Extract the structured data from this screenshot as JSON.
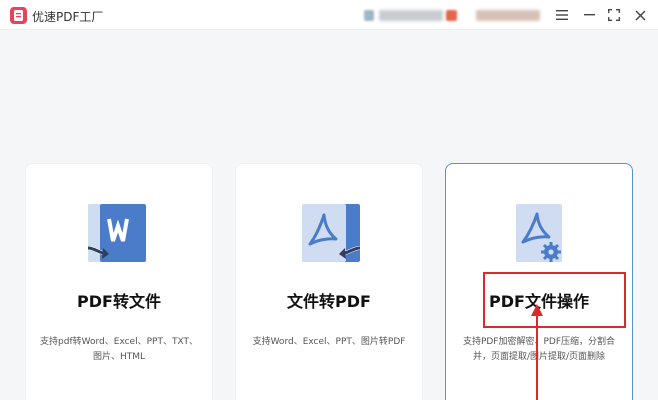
{
  "titlebar": {
    "app_title": "优速PDF工厂",
    "logo_icon": "app-logo-icon",
    "buttons": [
      "menu-icon",
      "minimize-icon",
      "maximize-icon",
      "close-icon"
    ]
  },
  "cards": [
    {
      "title": "PDF转文件",
      "description": "支持pdf转Word、Excel、PPT、TXT、图片、HTML",
      "icon": "pdf-to-word-icon"
    },
    {
      "title": "文件转PDF",
      "description": "支持Word、Excel、PPT、图片转PDF",
      "icon": "file-to-pdf-icon"
    },
    {
      "title": "PDF文件操作",
      "description": "支持PDF加密解密、PDF压缩，分割合并，页面提取/图片提取/页面删除",
      "icon": "pdf-settings-icon"
    }
  ],
  "colors": {
    "accent": "#5b8fd6",
    "icon_dark": "#4a7cc9",
    "icon_light": "#cfdcf2",
    "annotation": "#d92b2b",
    "brand": "#e8435b"
  }
}
